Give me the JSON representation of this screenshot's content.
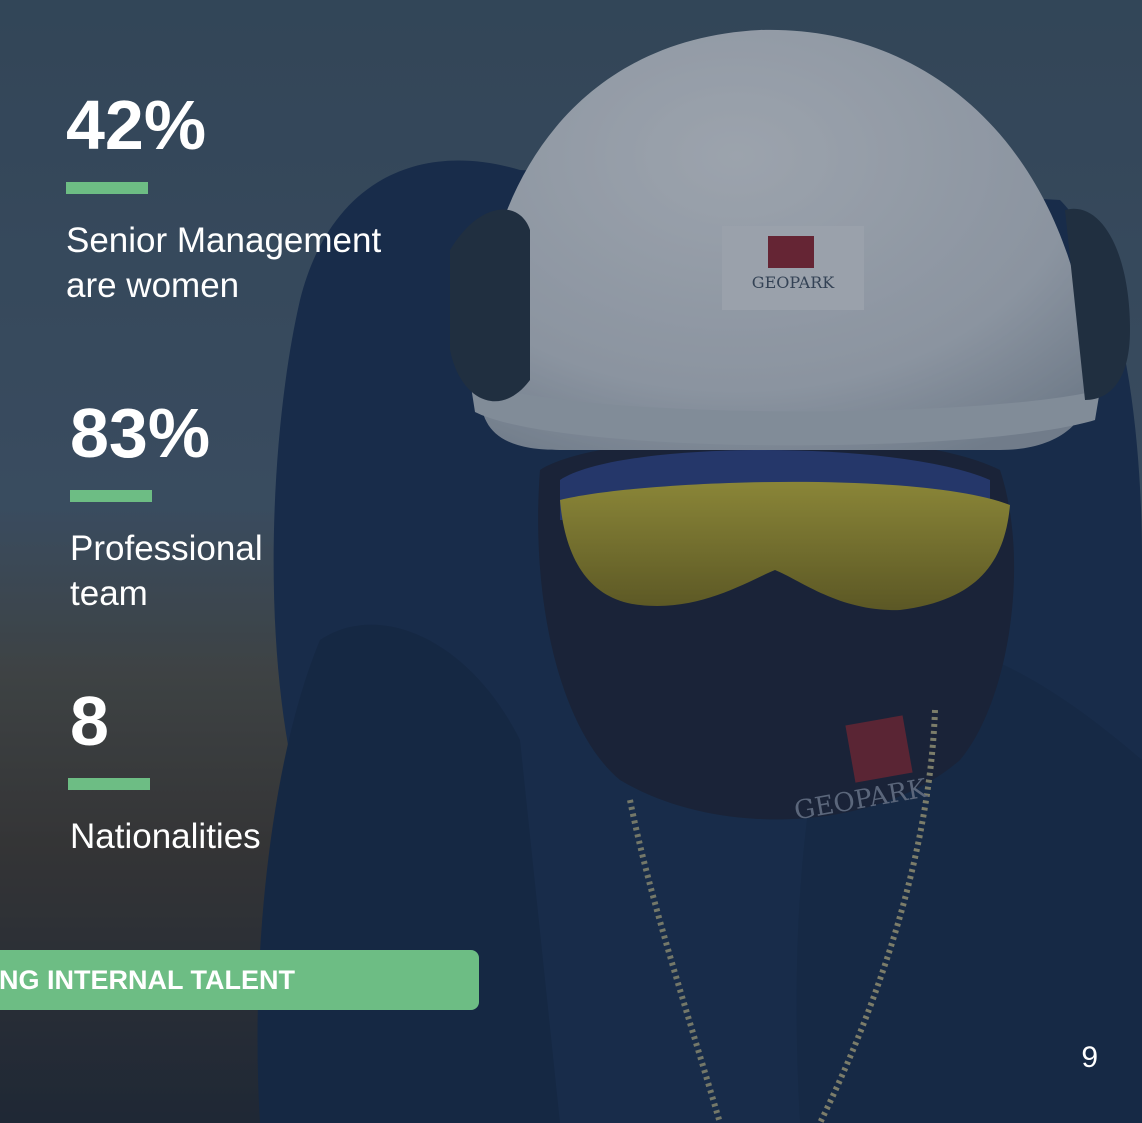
{
  "colors": {
    "accent": "#6dbd84",
    "overlay": "#0e1e34",
    "text": "#ffffff"
  },
  "background": {
    "description_icon": "worker-photo",
    "helmet_logo": "GEOPARK",
    "mask_logo": "GEOPARK"
  },
  "stats": [
    {
      "value": "42%",
      "label": "Senior Management\nare women"
    },
    {
      "value": "83%",
      "label": "Professional\nteam"
    },
    {
      "value": "8",
      "label": "Nationalities"
    }
  ],
  "banner": {
    "label": "OTING INTERNAL TALENT"
  },
  "page_number": "9"
}
